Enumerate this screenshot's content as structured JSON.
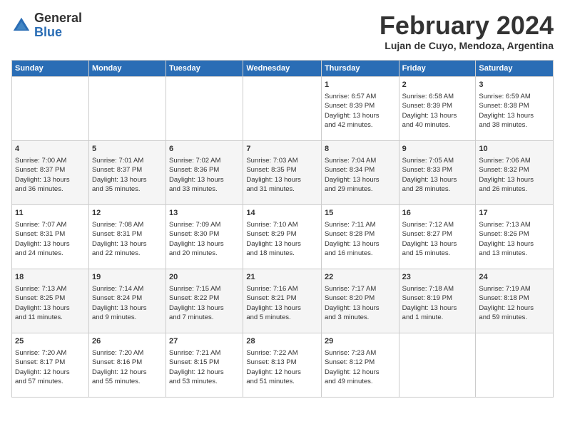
{
  "header": {
    "logo_general": "General",
    "logo_blue": "Blue",
    "title": "February 2024",
    "subtitle": "Lujan de Cuyo, Mendoza, Argentina"
  },
  "days_of_week": [
    "Sunday",
    "Monday",
    "Tuesday",
    "Wednesday",
    "Thursday",
    "Friday",
    "Saturday"
  ],
  "weeks": [
    [
      {
        "day": "",
        "info": ""
      },
      {
        "day": "",
        "info": ""
      },
      {
        "day": "",
        "info": ""
      },
      {
        "day": "",
        "info": ""
      },
      {
        "day": "1",
        "info": "Sunrise: 6:57 AM\nSunset: 8:39 PM\nDaylight: 13 hours\nand 42 minutes."
      },
      {
        "day": "2",
        "info": "Sunrise: 6:58 AM\nSunset: 8:39 PM\nDaylight: 13 hours\nand 40 minutes."
      },
      {
        "day": "3",
        "info": "Sunrise: 6:59 AM\nSunset: 8:38 PM\nDaylight: 13 hours\nand 38 minutes."
      }
    ],
    [
      {
        "day": "4",
        "info": "Sunrise: 7:00 AM\nSunset: 8:37 PM\nDaylight: 13 hours\nand 36 minutes."
      },
      {
        "day": "5",
        "info": "Sunrise: 7:01 AM\nSunset: 8:37 PM\nDaylight: 13 hours\nand 35 minutes."
      },
      {
        "day": "6",
        "info": "Sunrise: 7:02 AM\nSunset: 8:36 PM\nDaylight: 13 hours\nand 33 minutes."
      },
      {
        "day": "7",
        "info": "Sunrise: 7:03 AM\nSunset: 8:35 PM\nDaylight: 13 hours\nand 31 minutes."
      },
      {
        "day": "8",
        "info": "Sunrise: 7:04 AM\nSunset: 8:34 PM\nDaylight: 13 hours\nand 29 minutes."
      },
      {
        "day": "9",
        "info": "Sunrise: 7:05 AM\nSunset: 8:33 PM\nDaylight: 13 hours\nand 28 minutes."
      },
      {
        "day": "10",
        "info": "Sunrise: 7:06 AM\nSunset: 8:32 PM\nDaylight: 13 hours\nand 26 minutes."
      }
    ],
    [
      {
        "day": "11",
        "info": "Sunrise: 7:07 AM\nSunset: 8:31 PM\nDaylight: 13 hours\nand 24 minutes."
      },
      {
        "day": "12",
        "info": "Sunrise: 7:08 AM\nSunset: 8:31 PM\nDaylight: 13 hours\nand 22 minutes."
      },
      {
        "day": "13",
        "info": "Sunrise: 7:09 AM\nSunset: 8:30 PM\nDaylight: 13 hours\nand 20 minutes."
      },
      {
        "day": "14",
        "info": "Sunrise: 7:10 AM\nSunset: 8:29 PM\nDaylight: 13 hours\nand 18 minutes."
      },
      {
        "day": "15",
        "info": "Sunrise: 7:11 AM\nSunset: 8:28 PM\nDaylight: 13 hours\nand 16 minutes."
      },
      {
        "day": "16",
        "info": "Sunrise: 7:12 AM\nSunset: 8:27 PM\nDaylight: 13 hours\nand 15 minutes."
      },
      {
        "day": "17",
        "info": "Sunrise: 7:13 AM\nSunset: 8:26 PM\nDaylight: 13 hours\nand 13 minutes."
      }
    ],
    [
      {
        "day": "18",
        "info": "Sunrise: 7:13 AM\nSunset: 8:25 PM\nDaylight: 13 hours\nand 11 minutes."
      },
      {
        "day": "19",
        "info": "Sunrise: 7:14 AM\nSunset: 8:24 PM\nDaylight: 13 hours\nand 9 minutes."
      },
      {
        "day": "20",
        "info": "Sunrise: 7:15 AM\nSunset: 8:22 PM\nDaylight: 13 hours\nand 7 minutes."
      },
      {
        "day": "21",
        "info": "Sunrise: 7:16 AM\nSunset: 8:21 PM\nDaylight: 13 hours\nand 5 minutes."
      },
      {
        "day": "22",
        "info": "Sunrise: 7:17 AM\nSunset: 8:20 PM\nDaylight: 13 hours\nand 3 minutes."
      },
      {
        "day": "23",
        "info": "Sunrise: 7:18 AM\nSunset: 8:19 PM\nDaylight: 13 hours\nand 1 minute."
      },
      {
        "day": "24",
        "info": "Sunrise: 7:19 AM\nSunset: 8:18 PM\nDaylight: 12 hours\nand 59 minutes."
      }
    ],
    [
      {
        "day": "25",
        "info": "Sunrise: 7:20 AM\nSunset: 8:17 PM\nDaylight: 12 hours\nand 57 minutes."
      },
      {
        "day": "26",
        "info": "Sunrise: 7:20 AM\nSunset: 8:16 PM\nDaylight: 12 hours\nand 55 minutes."
      },
      {
        "day": "27",
        "info": "Sunrise: 7:21 AM\nSunset: 8:15 PM\nDaylight: 12 hours\nand 53 minutes."
      },
      {
        "day": "28",
        "info": "Sunrise: 7:22 AM\nSunset: 8:13 PM\nDaylight: 12 hours\nand 51 minutes."
      },
      {
        "day": "29",
        "info": "Sunrise: 7:23 AM\nSunset: 8:12 PM\nDaylight: 12 hours\nand 49 minutes."
      },
      {
        "day": "",
        "info": ""
      },
      {
        "day": "",
        "info": ""
      }
    ]
  ]
}
